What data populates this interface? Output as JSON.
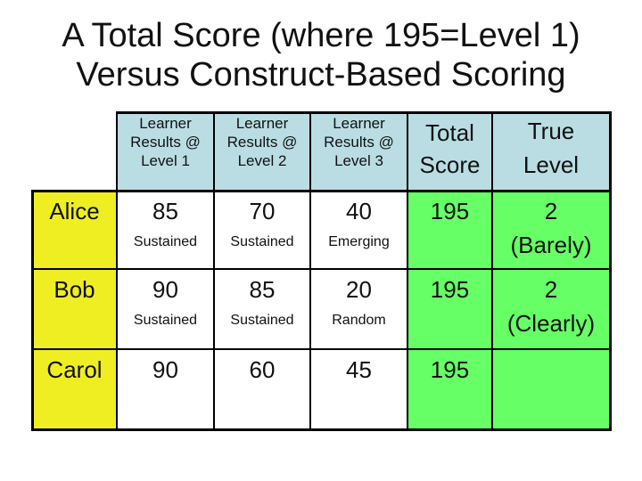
{
  "title": {
    "line1": "A Total Score (where 195=Level 1)",
    "line2": "Versus Construct-Based Scoring"
  },
  "headers": {
    "level1": [
      "Learner",
      "Results @",
      "Level 1"
    ],
    "level2": [
      "Learner",
      "Results @",
      "Level 2"
    ],
    "level3": [
      "Learner",
      "Results @",
      "Level 3"
    ],
    "total": [
      "Total",
      "Score"
    ],
    "true_level": [
      "True",
      "Level"
    ]
  },
  "rows": [
    {
      "name": "Alice",
      "level1": {
        "score": "85",
        "label": "Sustained"
      },
      "level2": {
        "score": "70",
        "label": "Sustained"
      },
      "level3": {
        "score": "40",
        "label": "Emerging"
      },
      "total": "195",
      "true_level": [
        "2",
        "(Barely)"
      ]
    },
    {
      "name": "Bob",
      "level1": {
        "score": "90",
        "label": "Sustained"
      },
      "level2": {
        "score": "85",
        "label": "Sustained"
      },
      "level3": {
        "score": "20",
        "label": "Random"
      },
      "total": "195",
      "true_level": [
        "2",
        "(Clearly)"
      ]
    },
    {
      "name": "Carol",
      "level1": {
        "score": "90",
        "label": ""
      },
      "level2": {
        "score": "60",
        "label": ""
      },
      "level3": {
        "score": "45",
        "label": ""
      },
      "total": "195",
      "true_level": [
        "",
        ""
      ]
    }
  ],
  "colors": {
    "header_bg": "#b9dde3",
    "name_bg": "#eeee22",
    "score_bg": "#ffffff",
    "result_bg": "#66ff66"
  }
}
